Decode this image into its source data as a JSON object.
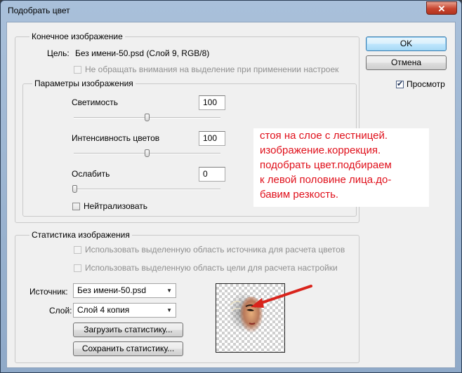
{
  "window": {
    "title": "Подобрать цвет",
    "close_glyph": "✕"
  },
  "target": {
    "legend": "Конечное изображение",
    "target_label": "Цель:",
    "target_value": "Без имени-50.psd (Слой 9, RGB/8)",
    "ignore_selection_label": "Не обращать внимания на выделение при применении настроек",
    "ignore_selection_checked": false
  },
  "image_options": {
    "legend": "Параметры изображения",
    "luminance_label": "Светимость",
    "luminance_value": "100",
    "luminance_level": 100,
    "color_intensity_label": "Интенсивность цветов",
    "color_intensity_value": "100",
    "color_intensity_level": 100,
    "fade_label": "Ослабить",
    "fade_value": "0",
    "fade_level": 0,
    "neutralize_label": "Нейтрализовать",
    "neutralize_checked": false
  },
  "buttons": {
    "ok": "OK",
    "cancel": "Отмена"
  },
  "preview": {
    "label": "Просмотр",
    "checked": true
  },
  "note": {
    "lines": [
      "стоя на слое с лестницей.",
      "изображение.коррекция.",
      "подобрать цвет.подбираем",
      "к левой половине лица.до-",
      "бавим резкость."
    ],
    "color": "#e0101b"
  },
  "statistics": {
    "legend": "Статистика изображения",
    "use_source_selection_label": "Использовать выделенную область источника для расчета цветов",
    "use_target_selection_label": "Использовать выделенную область цели для расчета настройки",
    "source_label": "Источник:",
    "source_value": "Без имени-50.psd",
    "layer_label": "Слой:",
    "layer_value": "Слой 4 копия",
    "load_button": "Загрузить статистику...",
    "save_button": "Сохранить статистику..."
  },
  "colors": {
    "arrow": "#d9241c",
    "title_bar": "#9fb8d6",
    "close_button": "#c7452f"
  }
}
